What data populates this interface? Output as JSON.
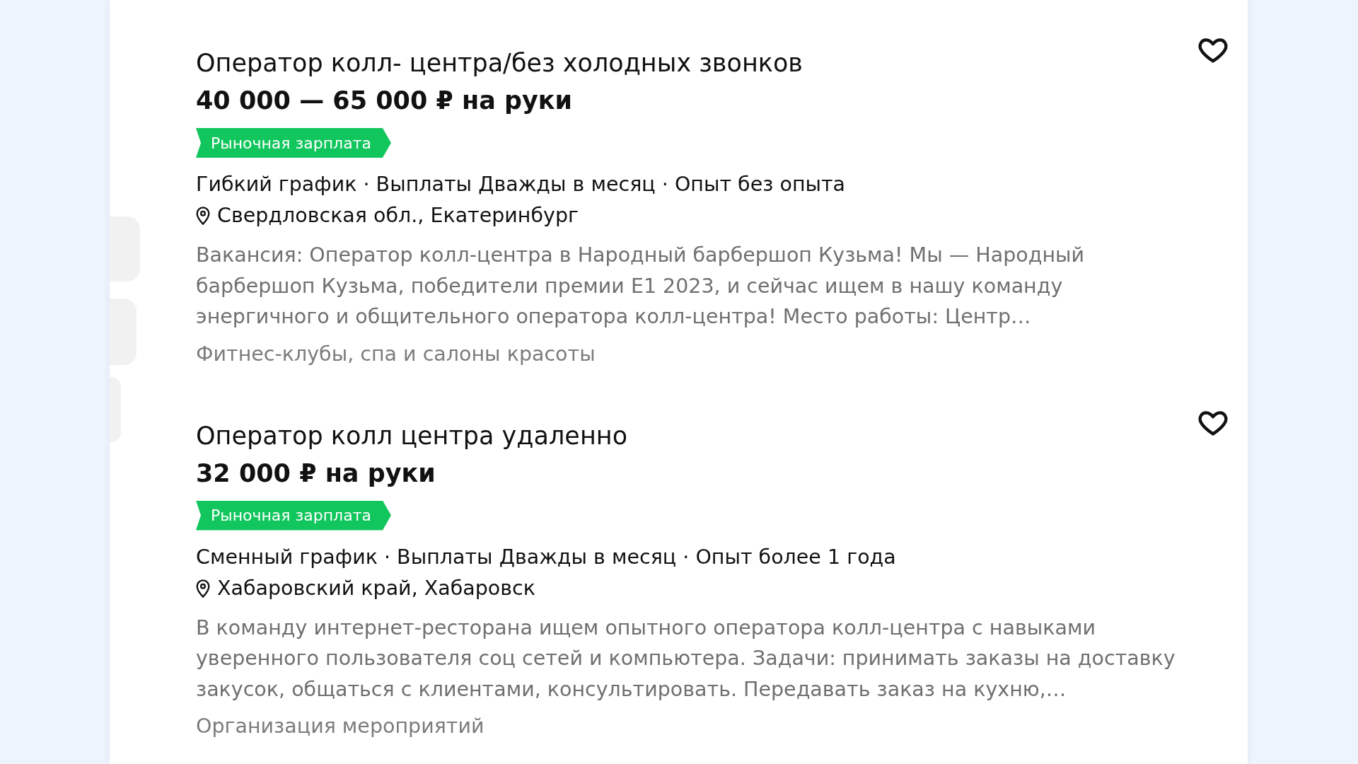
{
  "vacancies": [
    {
      "title": "Оператор колл- центра/без холодных звонков",
      "salary": "40 000 — 65 000 ₽ на руки",
      "badge": "Рыночная зарплата",
      "meta": "Гибкий график · Выплаты Дважды в месяц · Опыт без опыта",
      "location": "Свердловская обл., Екатеринбург",
      "description": "Вакансия: Оператор колл-центра в Народный барбершоп Кузьма! Мы — Народный\nбарбершоп Кузьма, победители премии E1 2023, и сейчас ищем в нашу команду\nэнергичного и общительного оператора колл-центра! Место работы: Центр…",
      "category": "Фитнес-клубы, спа и салоны красоты",
      "favorited": false
    },
    {
      "title": "Оператор колл центра удаленно",
      "salary": "32 000 ₽ на руки",
      "badge": "Рыночная зарплата",
      "meta": "Сменный график · Выплаты Дважды в месяц · Опыт более 1 года",
      "location": "Хабаровский край, Хабаровск",
      "description": "В команду интернет-ресторана ищем опытного оператора колл-центра с навыками\nуверенного пользователя соц сетей и компьютера. Задачи: принимать заказы на доставку\nзакусок, общаться с клиентами, консультировать. Передавать заказ на кухню,…",
      "category": "Организация мероприятий",
      "favorited": false
    }
  ]
}
